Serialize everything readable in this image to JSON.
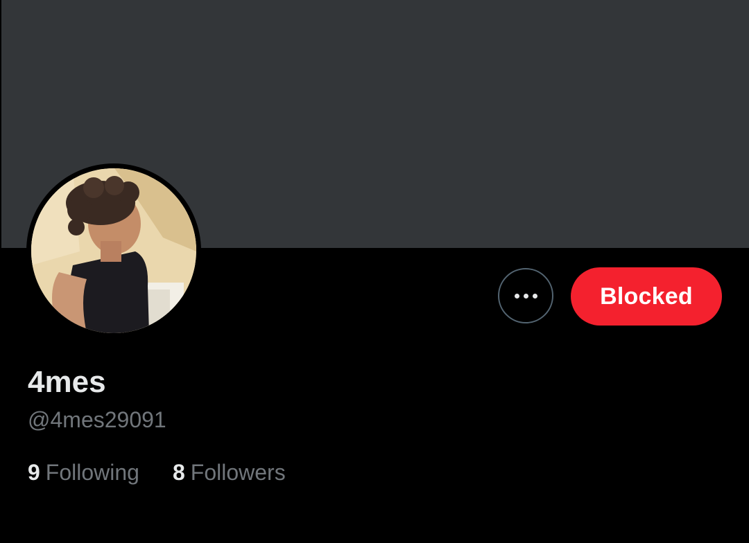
{
  "profile": {
    "display_name": "4mes",
    "handle": "@4mes29091",
    "following_count": "9",
    "following_label": "Following",
    "followers_count": "8",
    "followers_label": "Followers"
  },
  "actions": {
    "more_icon": "more-horizontal-icon",
    "blocked_label": "Blocked"
  },
  "colors": {
    "background": "#000000",
    "banner": "#333639",
    "blocked_button": "#f4212e",
    "primary_text": "#e7e9ea",
    "secondary_text": "#71767b"
  }
}
